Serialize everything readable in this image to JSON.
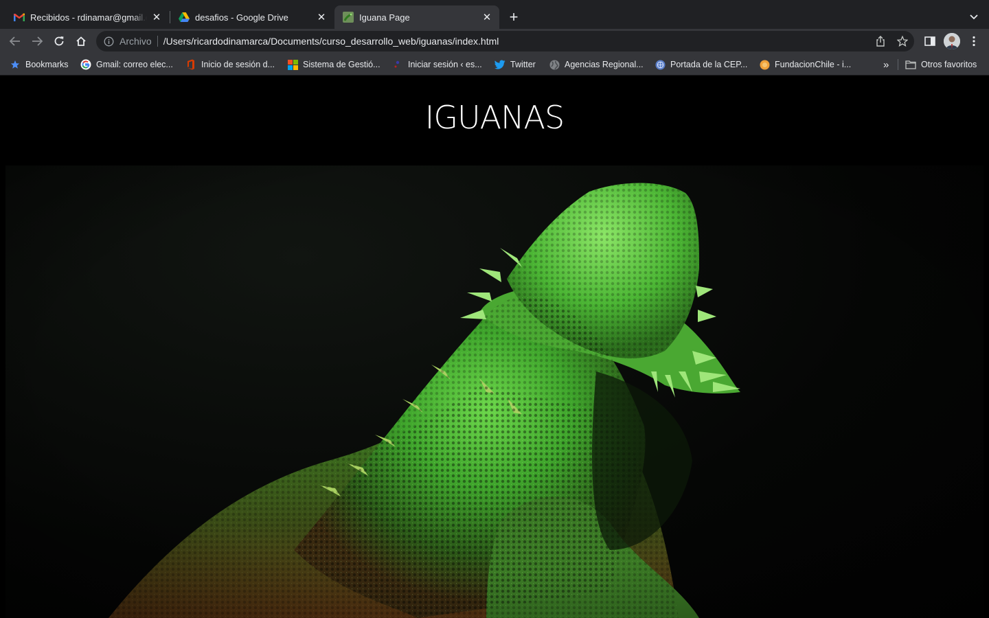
{
  "browser": {
    "tabs": [
      {
        "title": "Recibidos - rdinamar@gmail.com",
        "favicon": "gmail-icon",
        "active": false
      },
      {
        "title": "desafios - Google Drive",
        "favicon": "google-drive-icon",
        "active": false
      },
      {
        "title": "Iguana Page",
        "favicon": "iguana-favicon-icon",
        "active": true
      }
    ],
    "address": {
      "scheme_label": "Archivo",
      "url": "/Users/ricardodinamarca/Documents/curso_desarrollo_web/iguanas/index.html"
    },
    "bookmarks": [
      {
        "label": "Bookmarks",
        "icon": "star-icon"
      },
      {
        "label": "Gmail: correo elec...",
        "icon": "google-icon"
      },
      {
        "label": "Inicio de sesión d...",
        "icon": "office-icon"
      },
      {
        "label": "Sistema de Gestió...",
        "icon": "microsoft-icon"
      },
      {
        "label": "Iniciar sesión ‹ es...",
        "icon": "wordpress-icon"
      },
      {
        "label": "Twitter",
        "icon": "twitter-icon"
      },
      {
        "label": "Agencias Regional...",
        "icon": "globe-icon"
      },
      {
        "label": "Portada de la CEP...",
        "icon": "un-icon"
      },
      {
        "label": "FundacionChile - i...",
        "icon": "fundacion-icon"
      }
    ],
    "overflow_label": "»",
    "other_bookmarks": "Otros favoritos",
    "colors": {
      "tabstrip": "#202124",
      "toolbar": "#35363a",
      "omnibox": "#202124",
      "page_background": "#000000",
      "iguana_green": "#4fbf3a"
    }
  },
  "page": {
    "title": "IGUANAS",
    "hero_image": "green-iguana-photo"
  }
}
